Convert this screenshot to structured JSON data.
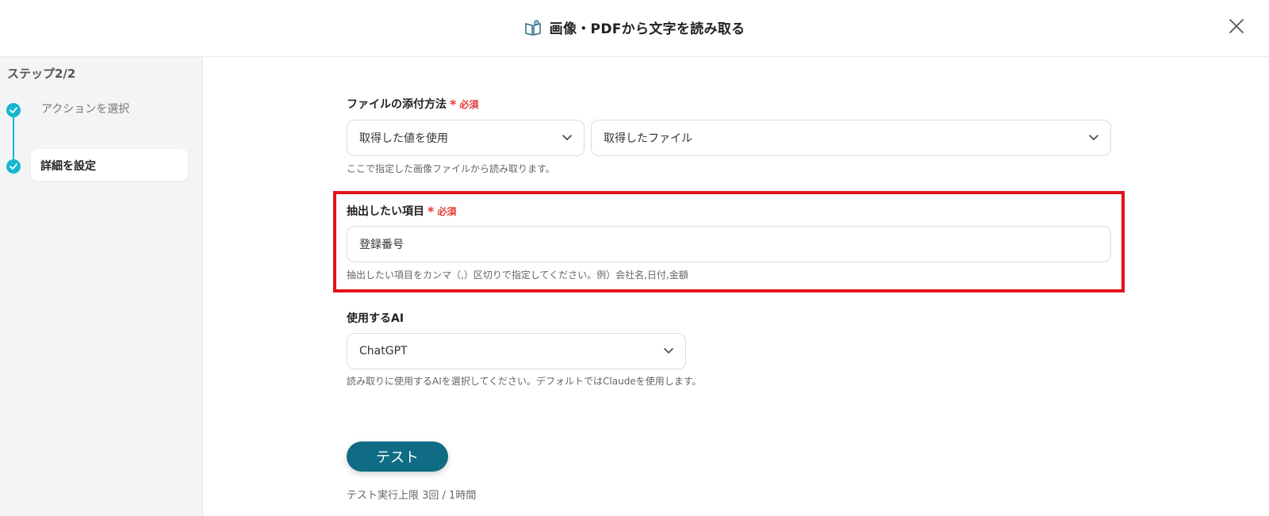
{
  "header": {
    "title": "画像・PDFから文字を読み取る",
    "title_icon": "book-icon",
    "close_icon": "close-icon"
  },
  "sidebar": {
    "step_title": "ステップ2/2",
    "steps": [
      {
        "label": "アクションを選択",
        "completed": true
      },
      {
        "label": "詳細を設定",
        "completed": true,
        "active": true
      }
    ]
  },
  "form": {
    "attach": {
      "label": "ファイルの添付方法",
      "required_mark": "*",
      "required_text": "必須",
      "method_value": "取得した値を使用",
      "file_value": "取得したファイル",
      "help": "ここで指定した画像ファイルから読み取ります。"
    },
    "extract": {
      "label": "抽出したい項目",
      "required_mark": "*",
      "required_text": "必須",
      "value": "登録番号",
      "help": "抽出したい項目をカンマ（,）区切りで指定してください。例）会社名,日付,金額"
    },
    "ai": {
      "label": "使用するAI",
      "value": "ChatGPT",
      "help": "読み取りに使用するAIを選択してください。デフォルトではClaudeを使用します。"
    },
    "test_button": "テスト",
    "limit_text": "テスト実行上限 3回 / 1時間"
  },
  "colors": {
    "accent": "#16b7cf",
    "button": "#0f6c84",
    "highlight": "#e3121a",
    "required": "#e53935"
  }
}
